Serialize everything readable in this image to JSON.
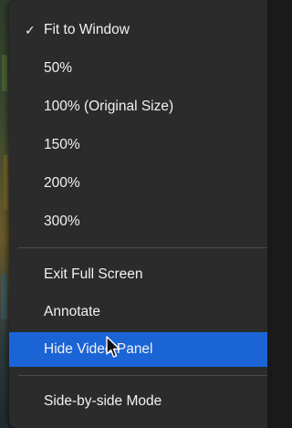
{
  "menu": {
    "items": [
      {
        "label": "Fit to Window",
        "checked": true
      },
      {
        "label": "50%"
      },
      {
        "label": "100% (Original Size)"
      },
      {
        "label": "150%"
      },
      {
        "label": "200%"
      },
      {
        "label": "300%"
      },
      {
        "label": "Exit Full Screen"
      },
      {
        "label": "Annotate"
      },
      {
        "label": "Hide Video Panel",
        "highlighted": true
      },
      {
        "label": "Side-by-side Mode"
      }
    ],
    "check_glyph": "✓",
    "highlight_color": "#1a64d6",
    "background_color": "#2b2b2b",
    "text_color": "#f2f2f2"
  },
  "icons": {
    "checkmark": "checkmark-icon",
    "pointer": "mouse-pointer-icon"
  }
}
